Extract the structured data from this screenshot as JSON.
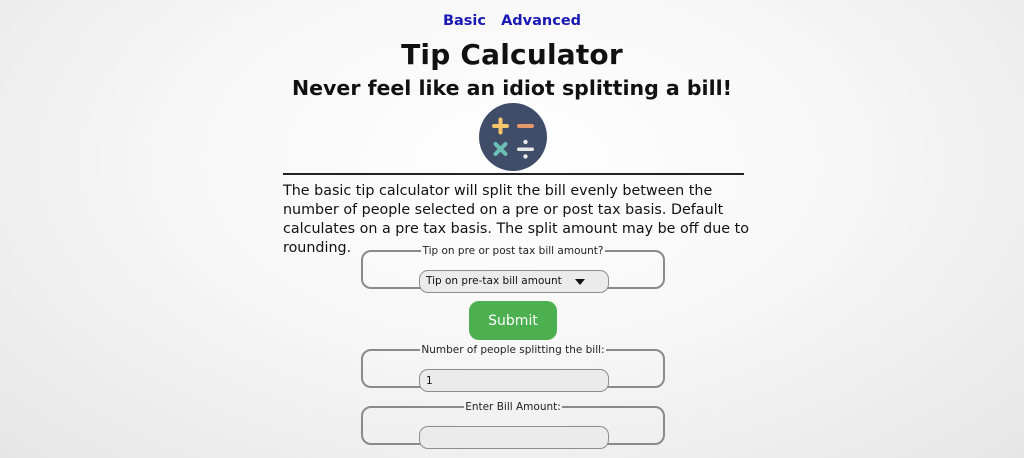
{
  "nav": {
    "basic_label": "Basic",
    "advanced_label": "Advanced"
  },
  "header": {
    "title": "Tip Calculator",
    "subtitle": "Never feel like an idiot splitting a bill!",
    "logo_icon": "calculator-operations-icon"
  },
  "description": "The basic tip calculator will split the bill evenly between the number of people selected on a pre or post tax basis. Default calculates on a pre tax basis. The split amount may be off due to rounding.",
  "form": {
    "tip_basis": {
      "legend": "Tip on pre or post tax bill amount?",
      "selected": "Tip on pre-tax bill amount"
    },
    "submit_label": "Submit",
    "people": {
      "legend": "Number of people splitting the bill:",
      "value": "1"
    },
    "bill": {
      "legend": "Enter Bill Amount:",
      "value": ""
    }
  },
  "colors": {
    "link": "#1a1ab4",
    "submit_bg": "#4caf50",
    "logo_bg": "#3f4d68",
    "plus": "#f6c56b",
    "minus": "#e59a6b",
    "times": "#6bbfb3",
    "divide": "#e8e8e8"
  }
}
